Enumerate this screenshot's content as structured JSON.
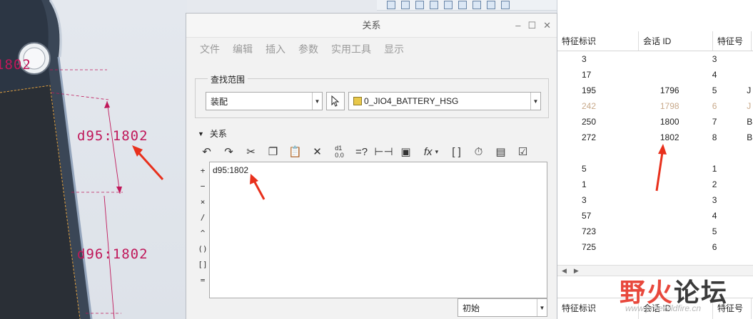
{
  "viewport": {
    "dims": [
      "1802",
      "d95:1802",
      "d96:1802"
    ],
    "colors": {
      "dimension": "#c0185a",
      "arrow": "#e8301c"
    }
  },
  "dialog": {
    "title": "关系",
    "menu": [
      "文件",
      "编辑",
      "插入",
      "参数",
      "实用工具",
      "显示"
    ],
    "scope_label": "查找范围",
    "scope_type": "装配",
    "scope_model": "0_JIO4_BATTERY_HSG",
    "section_label": "关系",
    "toolbar_icons": [
      "undo-icon",
      "redo-icon",
      "cut-icon",
      "copy-icon",
      "paste-icon",
      "delete-icon",
      "toggle-names-icon",
      "evaluate-icon",
      "measure-icon",
      "insert-param-icon",
      "function-icon",
      "brackets-icon",
      "verify-icon",
      "sort-icon",
      "execute-icon"
    ],
    "operators": [
      "+",
      "−",
      "×",
      "/",
      "^",
      "()",
      "[]",
      "="
    ],
    "relation_text": "d95:1802",
    "status": "初始"
  },
  "table": {
    "headers": [
      "特征标识",
      "会话 ID",
      "特征号"
    ],
    "rows": [
      {
        "fid": "3",
        "sid": "",
        "num": "3",
        "x": ""
      },
      {
        "fid": "17",
        "sid": "",
        "num": "4",
        "x": ""
      },
      {
        "fid": "195",
        "sid": "1796",
        "num": "5",
        "x": "J"
      },
      {
        "fid": "242",
        "sid": "1798",
        "num": "6",
        "x": "J",
        "dim": true
      },
      {
        "fid": "250",
        "sid": "1800",
        "num": "7",
        "x": "B"
      },
      {
        "fid": "272",
        "sid": "1802",
        "num": "8",
        "x": "B"
      },
      {
        "fid": "",
        "sid": "",
        "num": "",
        "x": ""
      },
      {
        "fid": "5",
        "sid": "",
        "num": "1",
        "x": ""
      },
      {
        "fid": "1",
        "sid": "",
        "num": "2",
        "x": ""
      },
      {
        "fid": "3",
        "sid": "",
        "num": "3",
        "x": ""
      },
      {
        "fid": "57",
        "sid": "",
        "num": "4",
        "x": ""
      },
      {
        "fid": "723",
        "sid": "",
        "num": "5",
        "x": ""
      },
      {
        "fid": "725",
        "sid": "",
        "num": "6",
        "x": ""
      }
    ],
    "bottom_headers": [
      "特征标识",
      "会话 ID",
      "特征号"
    ]
  },
  "watermark": {
    "chars": [
      "野",
      "火",
      "论",
      "坛"
    ],
    "url": "www.proewildfire.cn"
  }
}
